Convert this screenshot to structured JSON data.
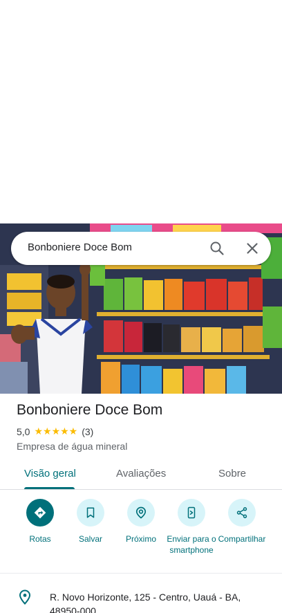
{
  "search": {
    "query": "Bonboniere Doce Bom",
    "search_icon": "search-icon",
    "close_icon": "close-icon"
  },
  "place": {
    "name": "Bonboniere Doce Bom",
    "rating": "5,0",
    "stars": "★★★★★",
    "review_count": "(3)",
    "category": "Empresa de água mineral",
    "photo_icon": "store-photo"
  },
  "tabs": [
    {
      "label": "Visão geral",
      "active": true
    },
    {
      "label": "Avaliações",
      "active": false
    },
    {
      "label": "Sobre",
      "active": false
    }
  ],
  "actions": [
    {
      "label": "Rotas",
      "icon": "directions-icon"
    },
    {
      "label": "Salvar",
      "icon": "bookmark-icon"
    },
    {
      "label": "Próximo",
      "icon": "nearby-icon"
    },
    {
      "label": "Enviar para o smartphone",
      "icon": "send-to-phone-icon"
    },
    {
      "label": "Compartilhar",
      "icon": "share-icon"
    }
  ],
  "address": {
    "text": "R. Novo Horizonte, 125 - Centro, Uauá - BA, 48950-000",
    "icon": "location-pin-icon"
  },
  "colors": {
    "accent": "#00707a",
    "accent_light": "#d7f4f9",
    "star": "#fbbc04"
  }
}
